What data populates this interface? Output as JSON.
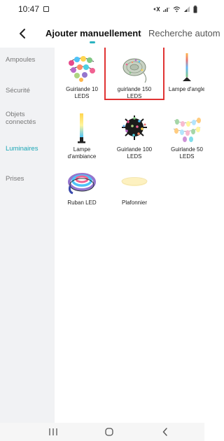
{
  "status_bar": {
    "time": "10:47",
    "icons": [
      "notification-icon",
      "mute-icon",
      "wifi-icon",
      "signal-icon",
      "battery-icon"
    ]
  },
  "header": {
    "back_icon": "chevron-left-icon",
    "tabs": [
      {
        "label": "Ajouter manuellement",
        "active": true
      },
      {
        "label": "Recherche autom",
        "active": false
      }
    ]
  },
  "sidebar": {
    "items": [
      {
        "label": "Ampoules",
        "active": false
      },
      {
        "label": "Sécurité",
        "active": false
      },
      {
        "label": "Objets connectés",
        "active": false
      },
      {
        "label": "Luminaires",
        "active": true
      },
      {
        "label": "Prises",
        "active": false
      }
    ]
  },
  "products": [
    {
      "label": "Guirlande 10 LEDS",
      "icon": "string-lights-icon"
    },
    {
      "label": "guirlande 150 LEDS",
      "icon": "fairy-lights-icon",
      "highlighted": true
    },
    {
      "label": "Lampe d'angle",
      "icon": "corner-lamp-icon"
    },
    {
      "label": "Lampe d'ambiance",
      "icon": "ambient-lamp-icon"
    },
    {
      "label": "Guirlande 100 LEDS",
      "icon": "led-cluster-icon"
    },
    {
      "label": "Guirlande 50 LEDS",
      "icon": "bulb-string-icon"
    },
    {
      "label": "Ruban LED",
      "icon": "led-strip-icon"
    },
    {
      "label": "Plafonnier",
      "icon": "ceiling-light-icon"
    }
  ],
  "colors": {
    "accent": "#2bb3c0",
    "highlight_border": "#e03333",
    "sidebar_bg": "#f1f2f4"
  },
  "nav_bar": {
    "icons": [
      "recent-apps-icon",
      "home-icon",
      "back-icon"
    ]
  }
}
